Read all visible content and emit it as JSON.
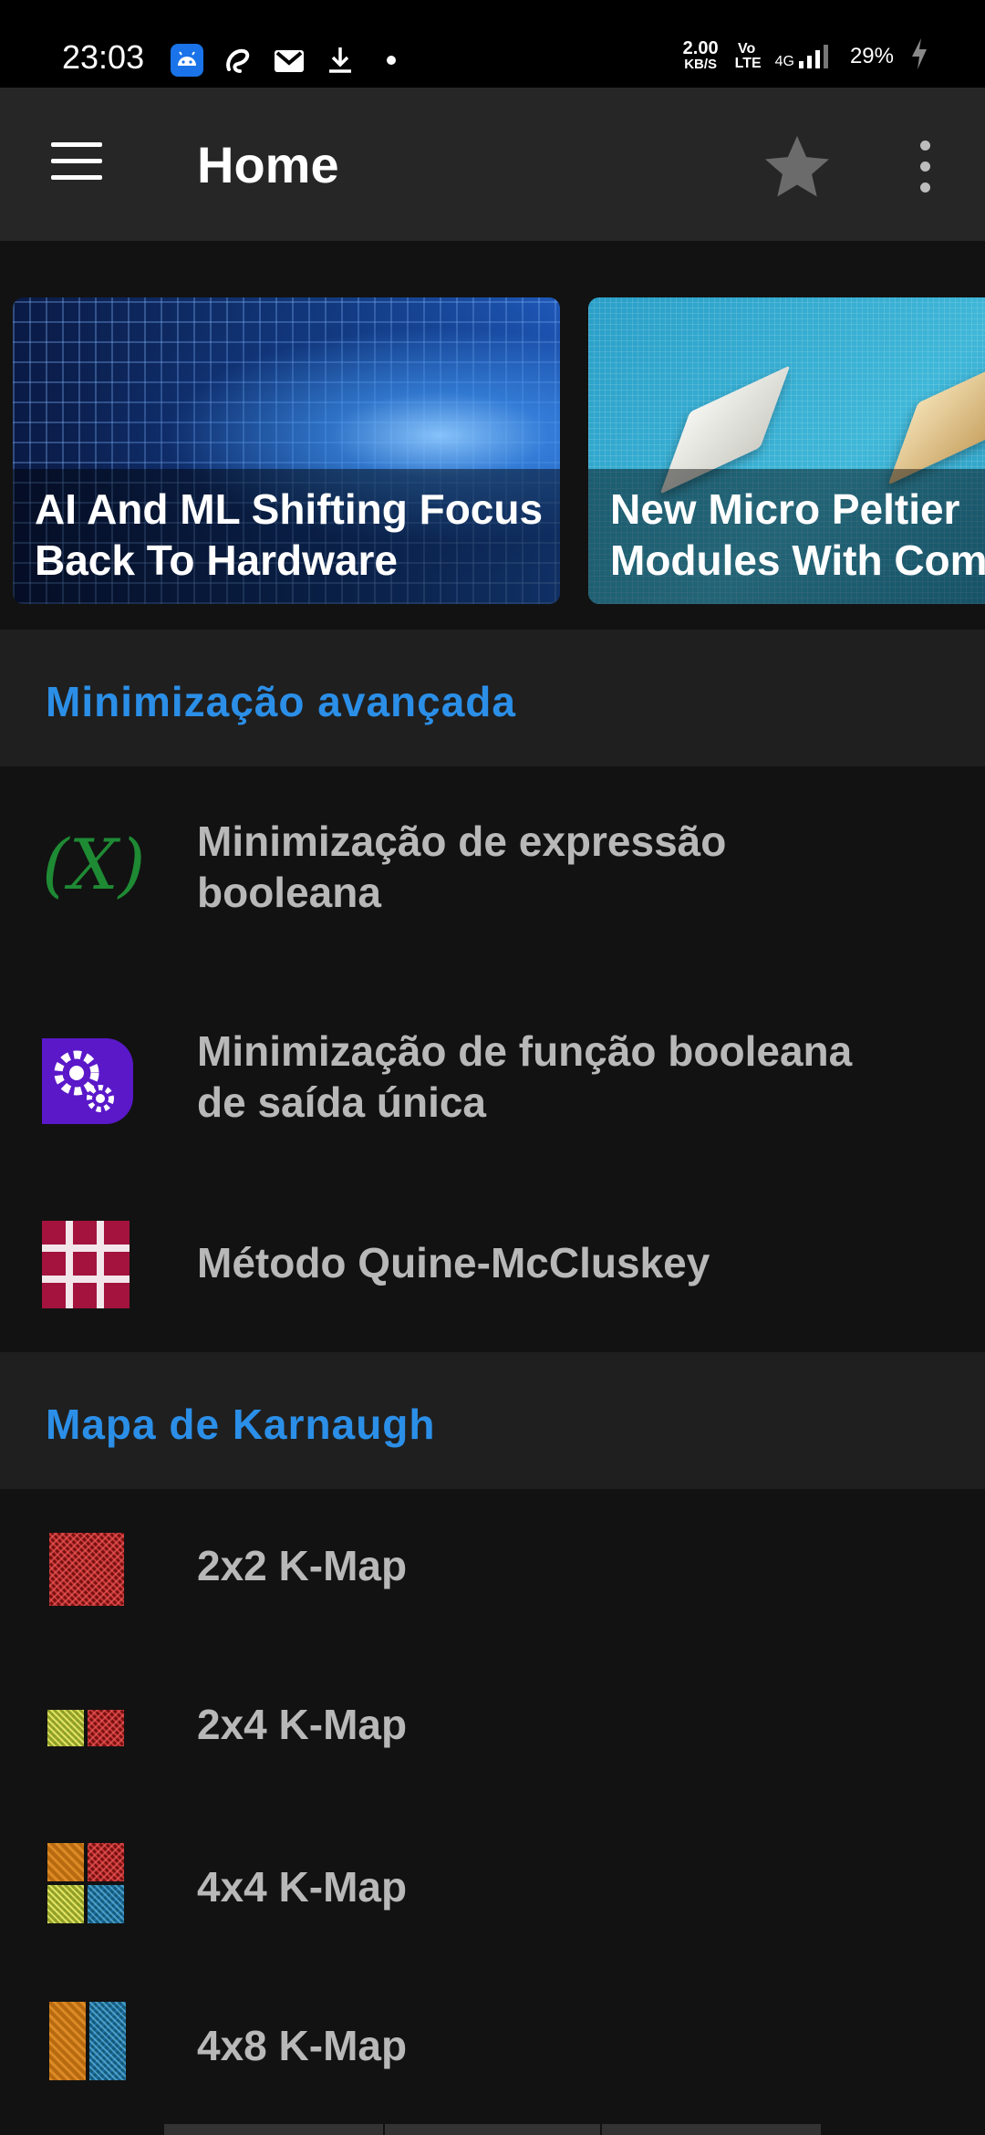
{
  "status_bar": {
    "time": "23:03",
    "speed_value": "2.00",
    "speed_unit": "KB/S",
    "volte": "Vo LTE",
    "network": "4G",
    "battery": "29%"
  },
  "app_bar": {
    "title": "Home"
  },
  "carousel": [
    {
      "caption_line1": "AI And ML Shifting Focus",
      "caption_line2": "Back To Hardware"
    },
    {
      "caption_line1": "New Micro Peltier",
      "caption_line2": "Modules With Com"
    }
  ],
  "sections": [
    {
      "header": "Minimização avançada",
      "items": [
        {
          "line1": "Minimização de expressão",
          "line2": "booleana",
          "icon": "boolean-expression-icon"
        },
        {
          "line1": "Minimização de função booleana",
          "line2": "de saída única",
          "icon": "gears-icon"
        },
        {
          "line1": "Método Quine-McCluskey",
          "icon": "grid-icon"
        }
      ]
    },
    {
      "header": "Mapa de Karnaugh",
      "items": [
        {
          "line1": "2x2 K-Map",
          "icon": "kmap-2x2-icon"
        },
        {
          "line1": "2x4 K-Map",
          "icon": "kmap-2x4-icon"
        },
        {
          "line1": "4x4 K-Map",
          "icon": "kmap-4x4-icon"
        },
        {
          "line1": "4x8 K-Map",
          "icon": "kmap-4x8-icon"
        }
      ]
    }
  ],
  "colors": {
    "accent": "#2b8fe8",
    "background": "#121212",
    "appbar": "#262626"
  }
}
